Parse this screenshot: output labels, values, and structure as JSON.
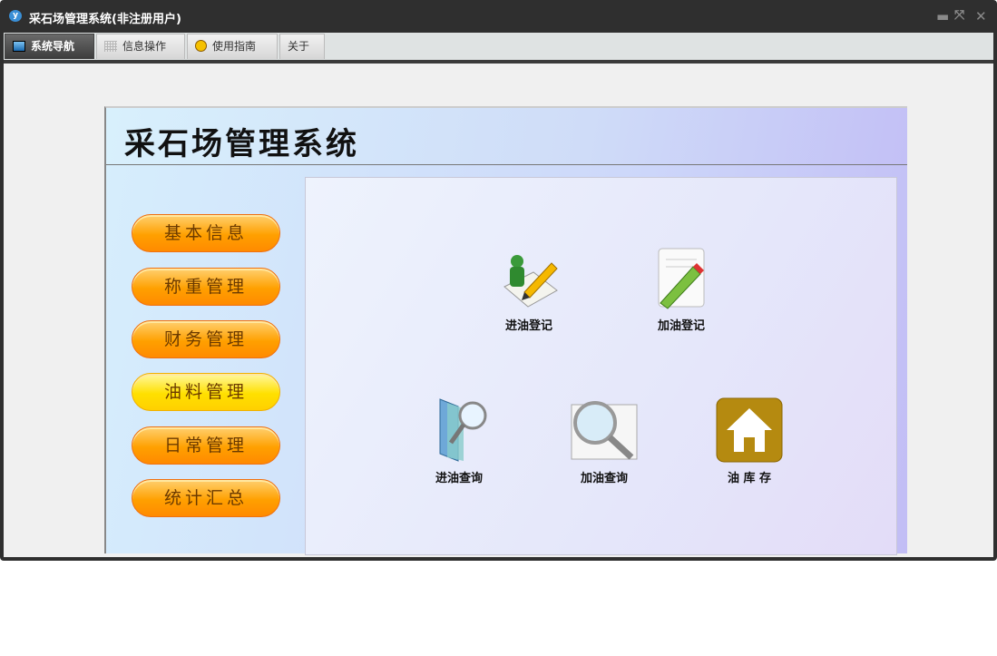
{
  "window": {
    "title": "采石场管理系统(非注册用户)"
  },
  "tabs": [
    {
      "label": "系统导航"
    },
    {
      "label": "信息操作"
    },
    {
      "label": "使用指南"
    },
    {
      "label": "关于"
    }
  ],
  "header": {
    "title": "采石场管理系统"
  },
  "menu": [
    {
      "label": "基本信息"
    },
    {
      "label": "称重管理"
    },
    {
      "label": "财务管理"
    },
    {
      "label": "油料管理"
    },
    {
      "label": "日常管理"
    },
    {
      "label": "统计汇总"
    }
  ],
  "items": [
    {
      "label": "进油登记"
    },
    {
      "label": "加油登记"
    },
    {
      "label": "进油查询"
    },
    {
      "label": "加油查询"
    },
    {
      "label": "油 库 存"
    }
  ]
}
